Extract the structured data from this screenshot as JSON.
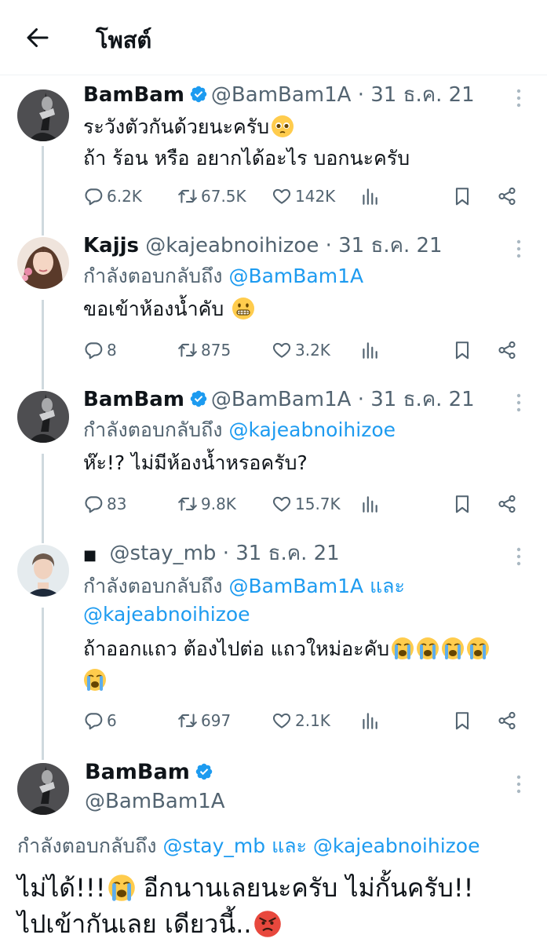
{
  "header": {
    "title": "โพสต์",
    "back_icon": "arrow-left-icon"
  },
  "tweets": [
    {
      "name": "BamBam",
      "verified": true,
      "handle_date": "@BamBam1A · 31 ธ.ค. 21",
      "lines": [
        "ระวังตัวกันด้วยนะครับ",
        "ถ้า ร้อน หรือ อยากได้อะไร บอกนะครับ"
      ],
      "emoji": "pleading-face",
      "stats": {
        "replies": "6.2K",
        "reposts": "67.5K",
        "likes": "142K"
      }
    },
    {
      "name": "Kajjs",
      "verified": false,
      "handle_date": "@kajeabnoihizoe · 31 ธ.ค. 21",
      "reply_prefix": "กำลังตอบกลับถึง",
      "reply_mention": "@BamBam1A",
      "lines": [
        "ขอเข้าห้องน้ำคับ"
      ],
      "emoji": "grimacing-face",
      "stats": {
        "replies": "8",
        "reposts": "875",
        "likes": "3.2K"
      }
    },
    {
      "name": "BamBam",
      "verified": true,
      "handle_date": "@BamBam1A · 31 ธ.ค. 21",
      "reply_prefix": "กำลังตอบกลับถึง",
      "reply_mention": "@kajeabnoihizoe",
      "lines": [
        "ห๊ะ!? ไม่มีห้องน้ำหรอครับ?"
      ],
      "stats": {
        "replies": "83",
        "reposts": "9.8K",
        "likes": "15.7K"
      }
    },
    {
      "name": "■",
      "verified": false,
      "handle_date": "@stay_mb · 31 ธ.ค. 21",
      "reply_prefix": "กำลังตอบกลับถึง",
      "reply_mention": "@BamBam1A",
      "reply_and": "และ",
      "reply_mention2": "@kajeabnoihizoe",
      "lines": [
        "ถ้าออกแถว ต้องไปต่อ แถวใหม่อะคับ"
      ],
      "emoji": "loudly-crying-face",
      "stats": {
        "replies": "6",
        "reposts": "697",
        "likes": "2.1K"
      }
    }
  ],
  "main_tweet": {
    "name": "BamBam",
    "verified": true,
    "handle": "@BamBam1A",
    "reply_prefix": "กำลังตอบกลับถึง",
    "reply_mention": "@stay_mb",
    "reply_and": "และ",
    "reply_mention2": "@kajeabnoihizoe",
    "line1_a": "ไม่ได้!!!",
    "line1_b": "อีกนานเลยนะครับ ไม่กั้นครับ!!",
    "line2": "ไปเข้ากันเลย เดียวนี้..",
    "emoji1": "loudly-crying-face",
    "emoji2": "angry-face"
  },
  "colors": {
    "accent": "#1d9bf0",
    "secondary": "#536471",
    "text": "#0f1419",
    "line": "#cfd9de"
  }
}
